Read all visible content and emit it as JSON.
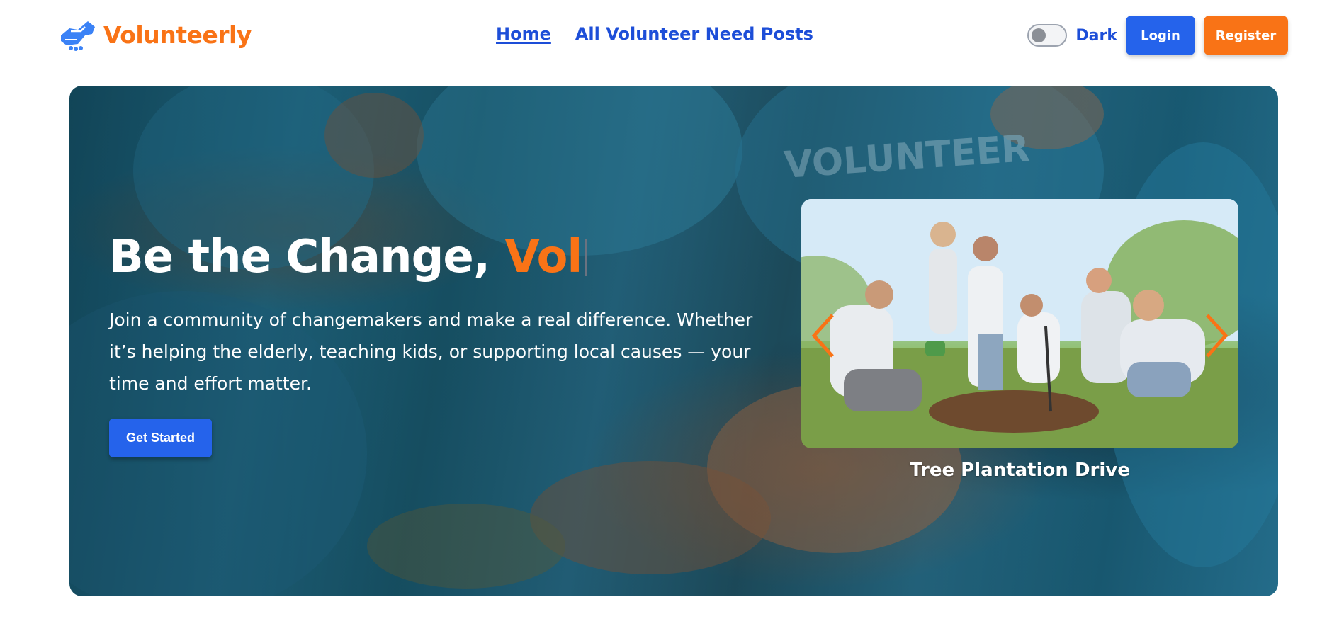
{
  "brand": {
    "name": "Volunteerly",
    "icon": "handshake-icon",
    "color": "#f97316",
    "icon_color": "#3b82f6"
  },
  "nav": {
    "links": [
      {
        "label": "Home",
        "active": true
      },
      {
        "label": "All Volunteer Need Posts",
        "active": false
      }
    ]
  },
  "theme_toggle": {
    "label": "Dark",
    "checked": false
  },
  "auth": {
    "login_label": "Login",
    "register_label": "Register"
  },
  "hero": {
    "title_prefix": "Be the Change, ",
    "title_typed": "Vol",
    "description": "Join a community of changemakers and make a real difference. Whether it’s helping the elderly, teaching kids, or supporting local causes — your time and effort matter.",
    "cta_label": "Get Started"
  },
  "carousel": {
    "caption": "Tree Plantation Drive",
    "prev_icon": "chevron-left-icon",
    "next_icon": "chevron-right-icon",
    "arrow_color": "#f97316"
  },
  "colors": {
    "primary": "#2563eb",
    "accent": "#f97316",
    "link": "#1d4ed8"
  }
}
